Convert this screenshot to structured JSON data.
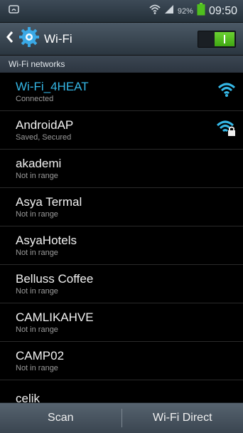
{
  "status_bar": {
    "battery_percent": "92%",
    "time": "09:50",
    "icons": [
      "notification-icon",
      "wifi-signal-icon",
      "cell-signal-icon",
      "battery-icon"
    ]
  },
  "action_bar": {
    "title": "Wi-Fi",
    "back_icon": "chevron-left-icon",
    "app_icon": "gear-icon",
    "toggle_state": "on"
  },
  "section": {
    "header": "Wi-Fi networks"
  },
  "networks": [
    {
      "name": "Wi-Fi_4HEAT",
      "status": "Connected",
      "connected": true,
      "icon": "wifi-strong-icon"
    },
    {
      "name": "AndroidAP",
      "status": "Saved, Secured",
      "connected": false,
      "icon": "wifi-locked-icon"
    },
    {
      "name": "akademi",
      "status": "Not in range"
    },
    {
      "name": "Asya Termal",
      "status": "Not in range"
    },
    {
      "name": "AsyaHotels",
      "status": "Not in range"
    },
    {
      "name": "Belluss Coffee",
      "status": "Not in range"
    },
    {
      "name": "CAMLIKAHVE",
      "status": "Not in range"
    },
    {
      "name": "CAMP02",
      "status": "Not in range"
    },
    {
      "name": "celik",
      "status": ""
    }
  ],
  "bottom_bar": {
    "scan_label": "Scan",
    "direct_label": "Wi-Fi Direct"
  },
  "colors": {
    "connected_accent": "#35b8e7",
    "toggle_on": "#4fbf1e"
  }
}
